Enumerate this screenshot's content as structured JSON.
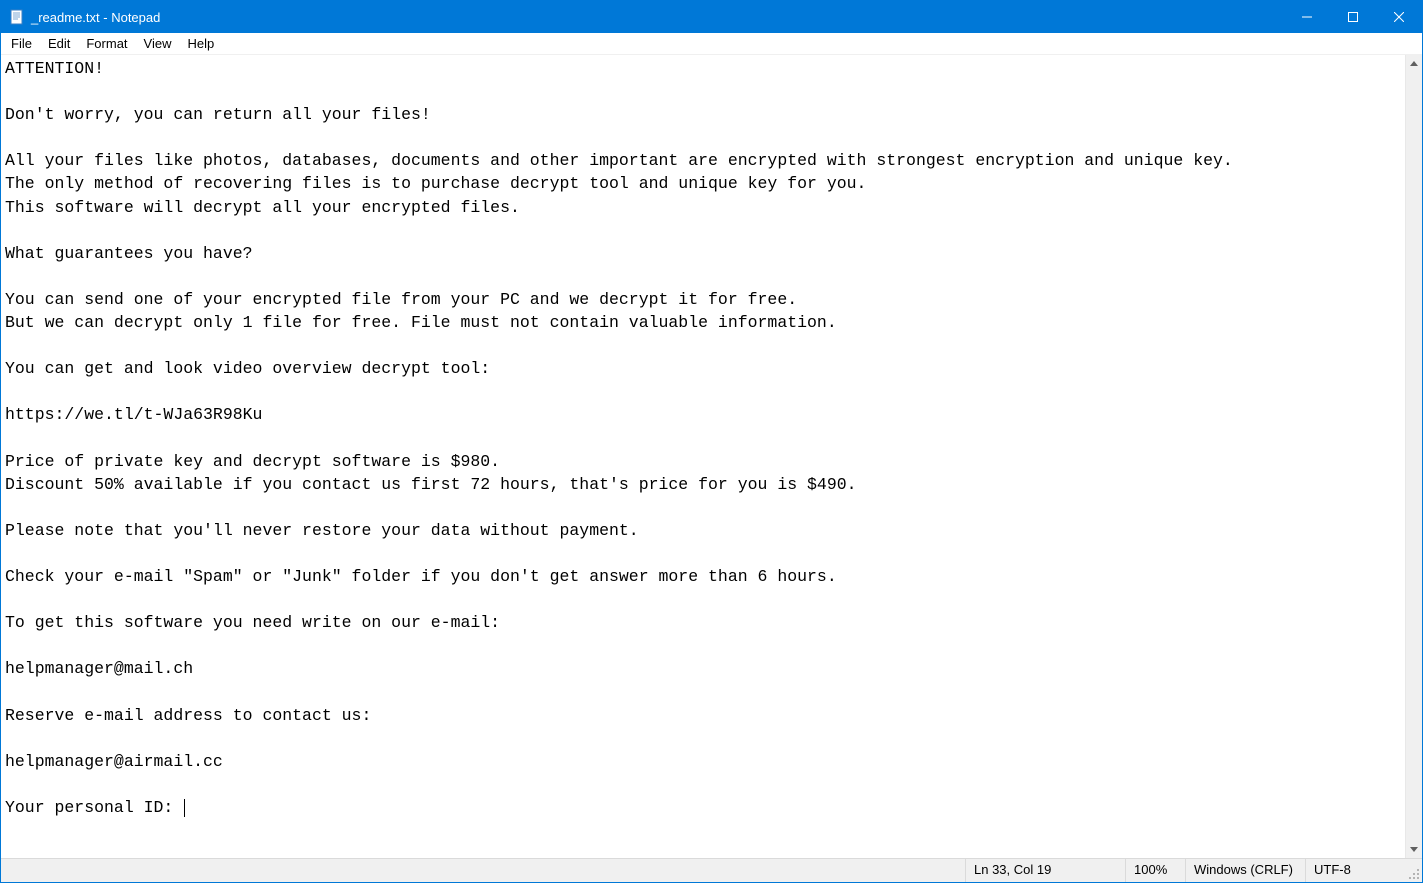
{
  "window": {
    "title": "_readme.txt - Notepad"
  },
  "menu": {
    "items": [
      "File",
      "Edit",
      "Format",
      "View",
      "Help"
    ]
  },
  "content": {
    "text": "ATTENTION!\n\nDon't worry, you can return all your files!\n\nAll your files like photos, databases, documents and other important are encrypted with strongest encryption and unique key.\nThe only method of recovering files is to purchase decrypt tool and unique key for you.\nThis software will decrypt all your encrypted files.\n\nWhat guarantees you have?\n\nYou can send one of your encrypted file from your PC and we decrypt it for free.\nBut we can decrypt only 1 file for free. File must not contain valuable information.\n\nYou can get and look video overview decrypt tool:\n\nhttps://we.tl/t-WJa63R98Ku\n\nPrice of private key and decrypt software is $980.\nDiscount 50% available if you contact us first 72 hours, that's price for you is $490.\n\nPlease note that you'll never restore your data without payment.\n\nCheck your e-mail \"Spam\" or \"Junk\" folder if you don't get answer more than 6 hours.\n\nTo get this software you need write on our e-mail:\n\nhelpmanager@mail.ch\n\nReserve e-mail address to contact us:\n\nhelpmanager@airmail.cc\n\nYour personal ID: "
  },
  "statusbar": {
    "position": "Ln 33, Col 19",
    "zoom": "100%",
    "line_ending": "Windows (CRLF)",
    "encoding": "UTF-8"
  }
}
